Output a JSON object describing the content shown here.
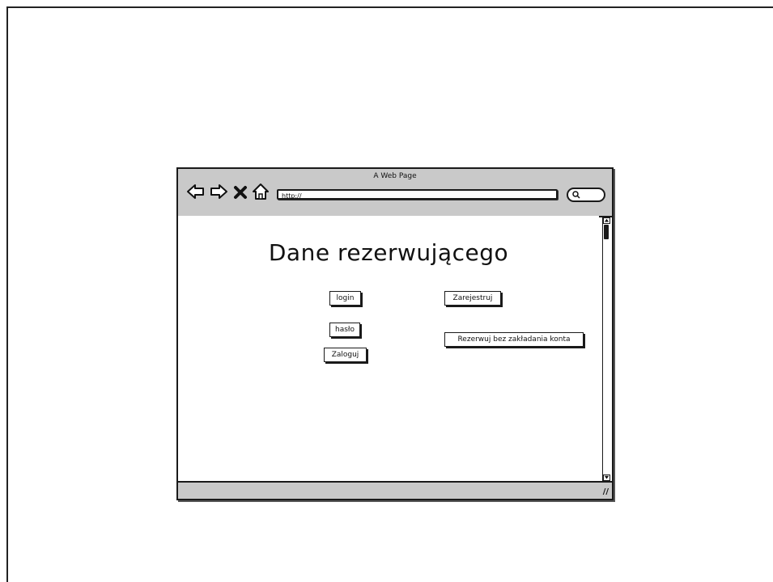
{
  "window": {
    "title": "A Web Page",
    "url": "http://"
  },
  "page": {
    "title": "Dane rezerwującego",
    "login_field": "login",
    "password_field": "hasło",
    "login_button": "Zaloguj",
    "register_button": "Zarejestruj",
    "guest_button": "Rezerwuj bez zakładania konta"
  },
  "icons": {
    "back": "back-arrow-icon",
    "forward": "forward-arrow-icon",
    "stop": "close-x-icon",
    "home": "home-icon",
    "search": "search-icon",
    "resize": "resize-grip-icon"
  }
}
